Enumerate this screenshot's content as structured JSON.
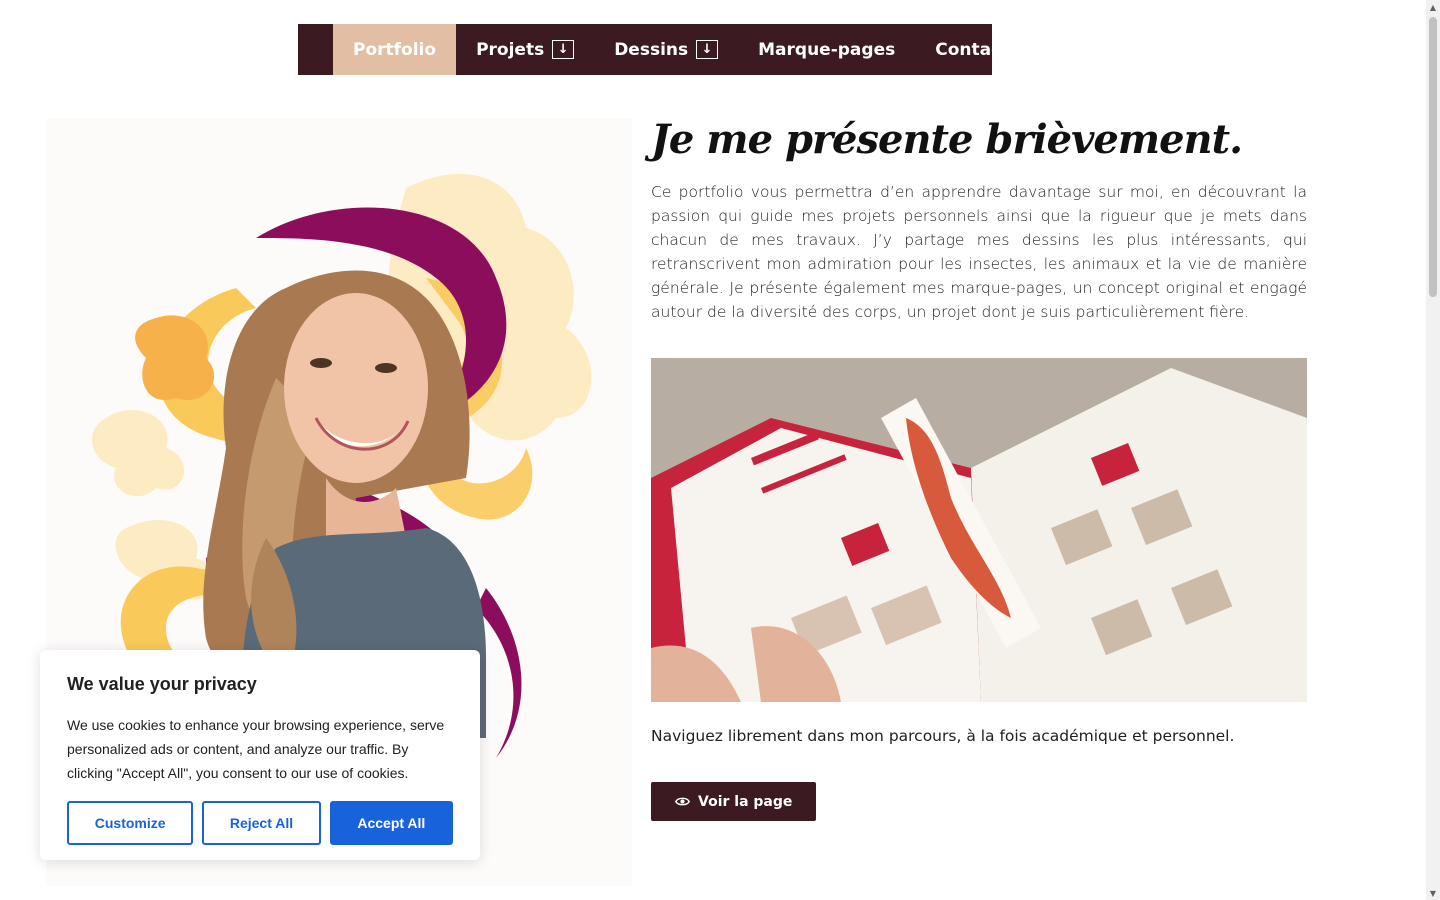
{
  "nav": {
    "items": [
      {
        "label": "Portfolio",
        "active": true,
        "dropdown": false
      },
      {
        "label": "Projets",
        "active": false,
        "dropdown": true
      },
      {
        "label": "Dessins",
        "active": false,
        "dropdown": true
      },
      {
        "label": "Marque-pages",
        "active": false,
        "dropdown": false
      },
      {
        "label": "Contact",
        "active": false,
        "dropdown": false
      }
    ],
    "dropdown_icon": "arrow-down-icon"
  },
  "main": {
    "headline": "Je me présente brièvement.",
    "intro": "Ce portfolio vous permettra d’en apprendre davantage sur moi, en découvrant la passion qui guide mes projets personnels ainsi que la rigueur que je mets dans chacun de mes travaux. J’y partage mes dessins les plus intéressants, qui retranscrivent mon admiration pour les insectes, les animaux et la vie de manière générale. Je présente également mes marque-pages, un concept original et engagé autour de la diversité des corps, un projet dont je suis particulièrement fière.",
    "navigate_text": "Naviguez librement dans mon parcours, à la fois académique et personnel.",
    "button_label": "Voir la page",
    "button_icon": "eye-icon"
  },
  "cookie": {
    "title": "We value your privacy",
    "text": "We use cookies to enhance your browsing experience, serve personalized ads or content, and analyze our traffic. By clicking \"Accept All\", you consent to our use of cookies.",
    "customize": "Customize",
    "reject": "Reject All",
    "accept": "Accept All"
  },
  "colors": {
    "nav_bg": "#3b1a21",
    "nav_active": "#e2bfa4",
    "accent_blue": "#1863dc",
    "shape_yellow": "#f9c95a",
    "shape_purple": "#8c0d5c"
  }
}
